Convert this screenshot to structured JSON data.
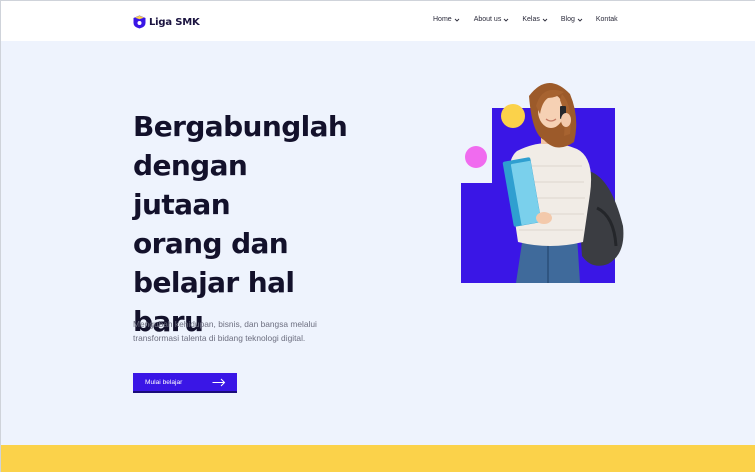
{
  "brand": {
    "name": "Liga SMK",
    "icon": "shield-logo-icon"
  },
  "nav": {
    "items": [
      {
        "label": "Home",
        "dropdown": true
      },
      {
        "label": "About us",
        "dropdown": true
      },
      {
        "label": "Kelas",
        "dropdown": true
      },
      {
        "label": "Blog",
        "dropdown": true
      },
      {
        "label": "Kontak",
        "dropdown": false
      }
    ]
  },
  "hero": {
    "headline": [
      "Bergabunglah",
      "dengan jutaan",
      "orang dan",
      "belajar hal",
      "baru"
    ],
    "subtitle": "Mengubah kehidupan, bisnis, dan bangsa melalui transformasi talenta di bidang teknologi digital.",
    "cta_label": "Mulai belajar",
    "cta_icon": "arrow-right-icon"
  },
  "colors": {
    "primary": "#3a16e6",
    "hero_bg": "#eef3fd",
    "accent_yellow": "#fbd24a",
    "accent_pink": "#f06bef",
    "heading": "#13112b",
    "body_text": "#6d6f80"
  }
}
